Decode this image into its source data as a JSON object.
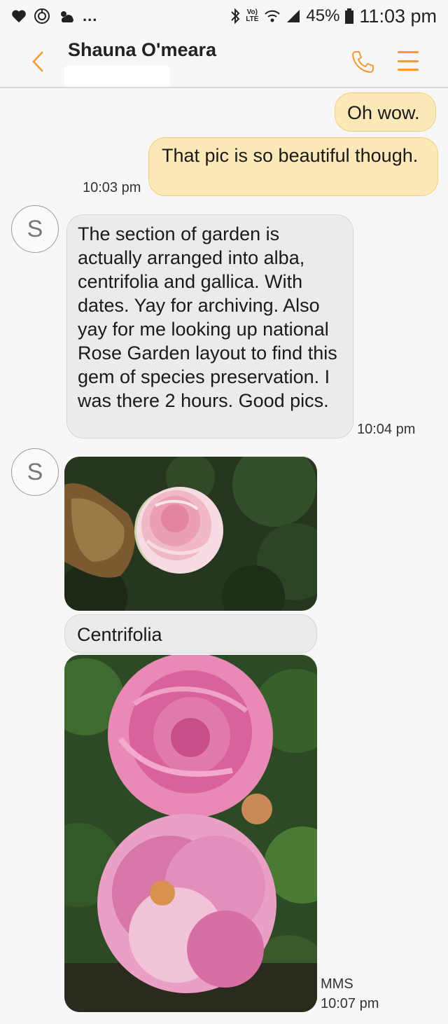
{
  "status_bar": {
    "battery": "45%",
    "time": "11:03 pm",
    "volte_line1": "Vo)",
    "volte_line2": "LTE",
    "dots": "...",
    "icons": [
      "heart-icon",
      "sync-icon",
      "weather-icon",
      "bluetooth-icon",
      "volte-icon",
      "wifi-icon",
      "signal-icon",
      "battery-icon"
    ]
  },
  "header": {
    "contact_name": "Shauna O'meara",
    "icons": [
      "back-icon",
      "phone-icon",
      "menu-icon"
    ],
    "accent_color": "#f29a33"
  },
  "conversation": {
    "sent": [
      {
        "text": "Oh wow."
      },
      {
        "text": "That pic is so beautiful though.",
        "time": "10:03 pm"
      }
    ],
    "received": [
      {
        "avatar_letter": "S",
        "text": "The section of garden is actually arranged into alba, centrifolia and gallica. With dates. Yay for archiving. Also yay for me looking up national Rose Garden layout to find this gem of species preservation. I was there 2 hours. Good pics.",
        "time": "10:04 pm"
      },
      {
        "avatar_letter": "S",
        "images": [
          "pale pink rose photo",
          "pink centifolia rose photo"
        ],
        "caption": "Centrifolia",
        "type_label": "MMS",
        "time": "10:07 pm"
      }
    ]
  },
  "colors": {
    "sent_bubble": "#fde9b8",
    "received_bubble": "#ebebeb",
    "background": "#f7f7f7"
  }
}
